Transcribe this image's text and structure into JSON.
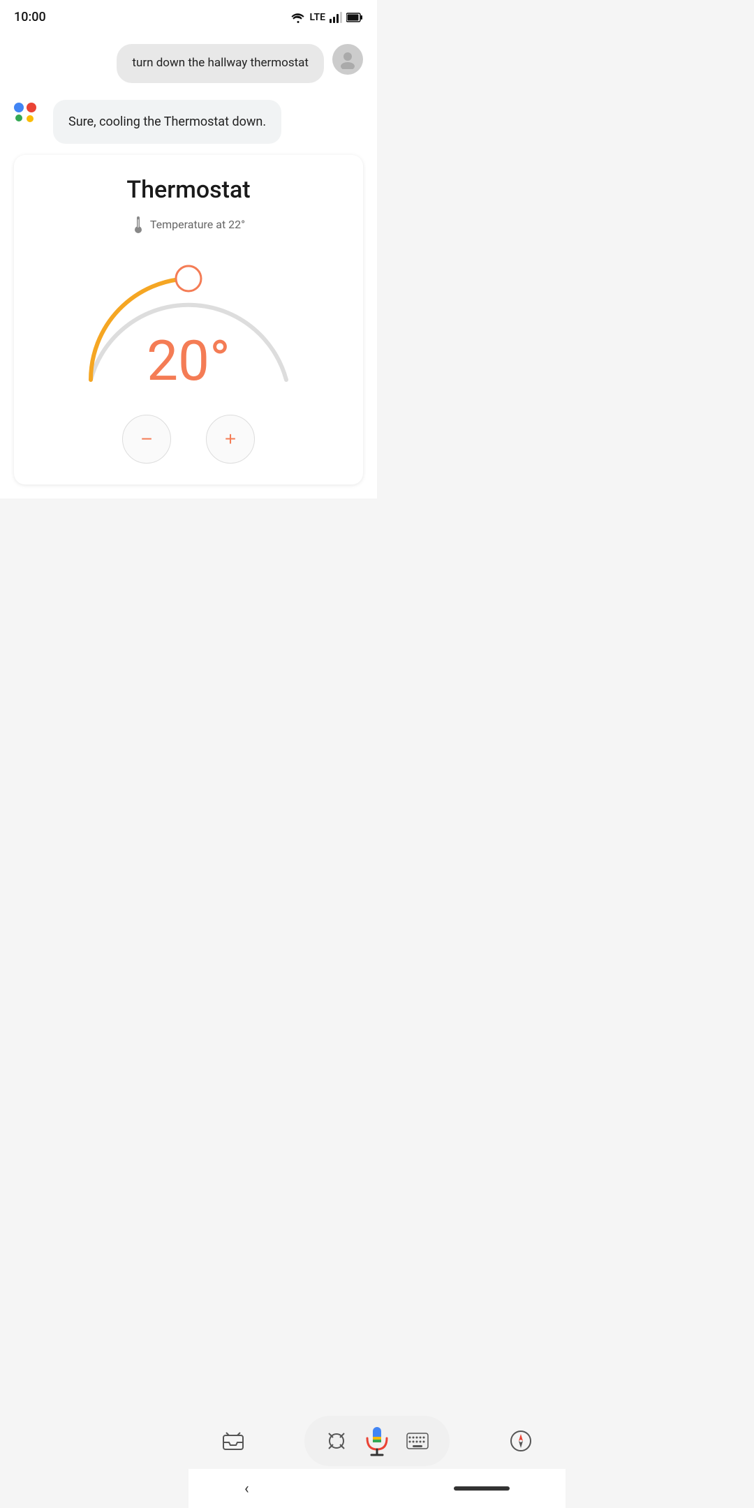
{
  "statusBar": {
    "time": "10:00",
    "wifi": "wifi",
    "lte": "LTE",
    "signal": "signal",
    "battery": "battery"
  },
  "userMessage": {
    "text": "turn down the hallway thermostat"
  },
  "assistantResponse": {
    "text": "Sure, cooling the Thermostat down."
  },
  "thermostatCard": {
    "title": "Thermostat",
    "tempLabel": "Temperature at 22°",
    "currentTemp": "20°",
    "decreaseLabel": "−",
    "increaseLabel": "+"
  },
  "bottomBar": {
    "lensLabel": "lens",
    "micLabel": "microphone",
    "keyboardLabel": "keyboard",
    "compassLabel": "compass",
    "homeLabel": "home"
  }
}
